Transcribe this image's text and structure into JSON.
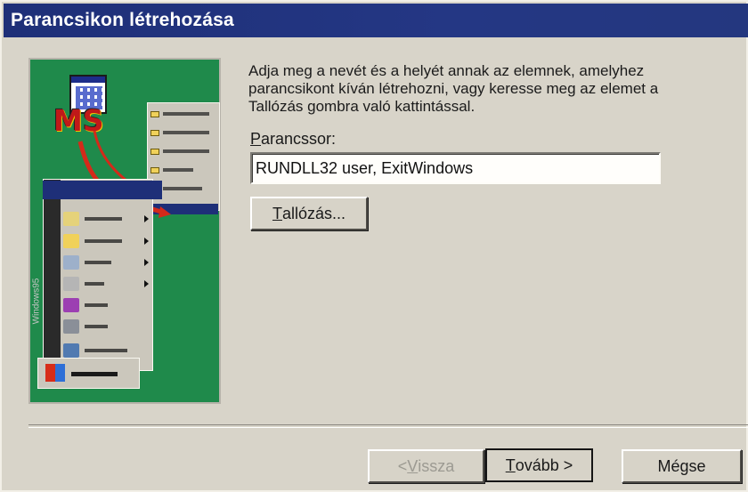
{
  "window": {
    "title": "Parancsikon létrehozása"
  },
  "description": "Adja meg a nevét és a helyét annak az elemnek, amelyhez parancsikont kíván létrehozni, vagy keresse meg az elemet a Tallózás gombra való kattintással.",
  "command": {
    "label_mnemonic": "P",
    "label_rest": "arancssor:",
    "value": "RUNDLL32 user, ExitWindows"
  },
  "buttons": {
    "browse_mnemonic": "T",
    "browse_rest": "allózás...",
    "back_prefix": "< ",
    "back_mnemonic": "V",
    "back_rest": "issza",
    "next_mnemonic": "T",
    "next_rest": "ovább >",
    "cancel": "Mégse"
  },
  "illustration": {
    "start_menu_brand": "Windows95"
  },
  "colors": {
    "title_bar": "#1e2f78",
    "illustration_bg": "#1f8a4b",
    "dialog_bg": "#d8d4c9"
  }
}
